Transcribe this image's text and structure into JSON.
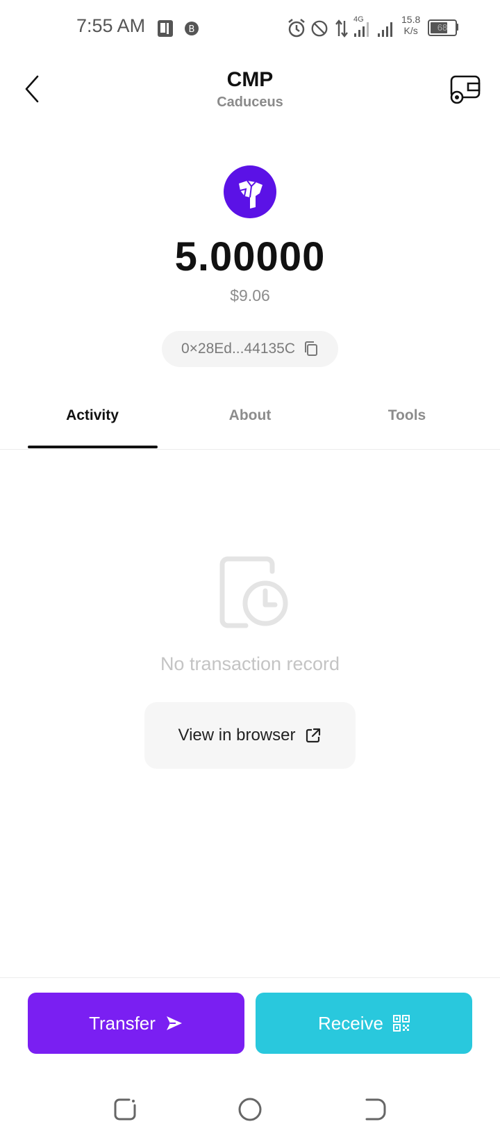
{
  "status_bar": {
    "time": "7:55 AM",
    "network": "4G",
    "speed_value": "15.8",
    "speed_unit": "K/s",
    "battery": "68",
    "icons": [
      "p-app-icon",
      "b-app-icon",
      "alarm-icon",
      "dnd-icon",
      "data-arrows-icon",
      "signal-icon",
      "signal-icon",
      "battery-icon"
    ]
  },
  "header": {
    "title": "CMP",
    "subtitle": "Caduceus",
    "back_icon": "chevron-left-icon",
    "settings_icon": "wallet-settings-icon"
  },
  "token": {
    "balance": "5.00000",
    "fiat_value": "$9.06",
    "address": "0×28Ed...44135C",
    "logo_icon": "caduceus-logo-icon",
    "logo_color": "#5b12e6"
  },
  "tabs": [
    {
      "label": "Activity",
      "active": true
    },
    {
      "label": "About",
      "active": false
    },
    {
      "label": "Tools",
      "active": false
    }
  ],
  "empty_state": {
    "message": "No transaction record",
    "icon": "history-document-icon",
    "button_label": "View in browser"
  },
  "actions": {
    "transfer_label": "Transfer",
    "receive_label": "Receive",
    "transfer_color": "#7a1ff2",
    "receive_color": "#29c8dd"
  },
  "nav_bar": {
    "icons": [
      "recents-icon",
      "home-icon",
      "back-icon"
    ]
  }
}
